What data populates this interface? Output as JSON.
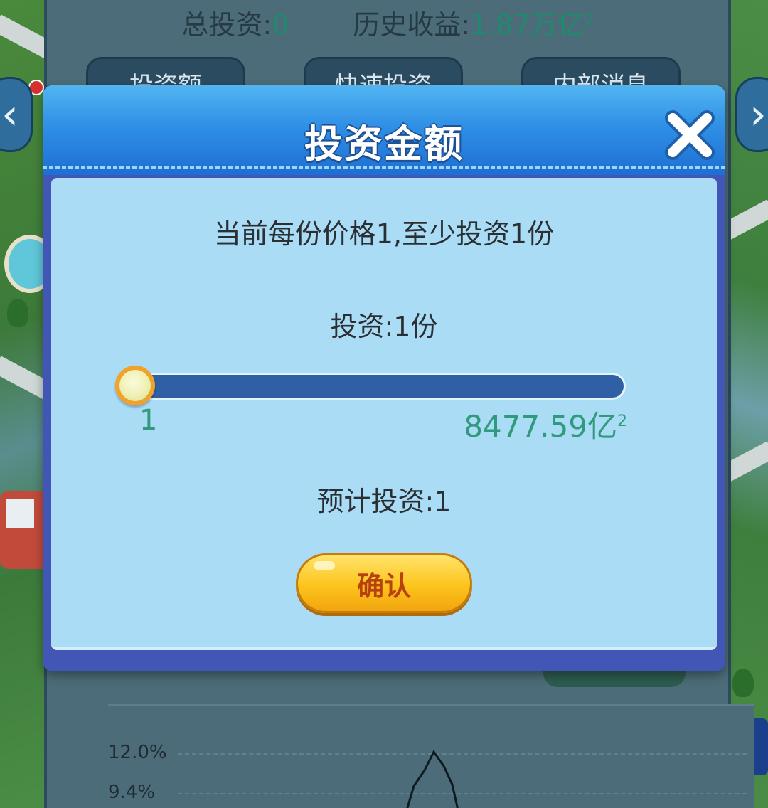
{
  "stats": {
    "total_invest_label": "总投资:",
    "total_invest_value": "0",
    "history_label": "历史收益:",
    "history_value": "1.87万亿",
    "history_sup": "2"
  },
  "tabs": [
    {
      "label": "投资额"
    },
    {
      "label": "快速投资"
    },
    {
      "label": "内部消息"
    }
  ],
  "nav": {
    "left_icon": "chevron-left-icon",
    "right_icon": "chevron-right-icon"
  },
  "chart": {
    "ticks": [
      "12.0%",
      "9.4%"
    ]
  },
  "modal": {
    "title": "投资金额",
    "close_icon": "close-icon",
    "price_text": "当前每份价格1,至少投资1份",
    "invest_text": "投资:1份",
    "slider": {
      "min_label": "1",
      "max_label": "8477.59亿",
      "max_sup": "2",
      "value_fraction": 0
    },
    "estimate_text": "预计投资:1",
    "confirm_label": "确认"
  },
  "colors": {
    "header_blue": "#2f90e6",
    "body_light_blue": "#abdcf6",
    "slider_track": "#2f5fa4",
    "value_green": "#2f9a7c",
    "confirm_yellow": "#fcc41c",
    "confirm_text": "#b8420f"
  }
}
